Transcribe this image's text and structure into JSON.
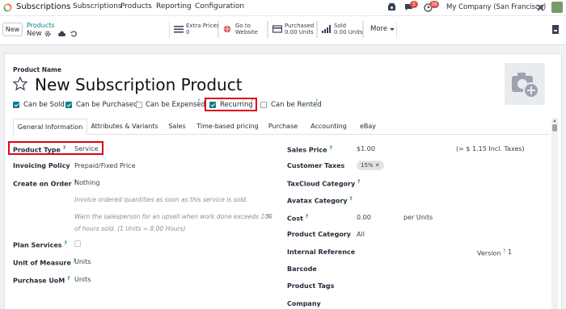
{
  "navbar": {
    "app_name": "Subscriptions",
    "menus": [
      "Subscriptions",
      "Products",
      "Reporting",
      "Configuration"
    ],
    "chat_count": "5",
    "activity_count": "36",
    "company": "My Company (San Francisco)"
  },
  "control_panel": {
    "new_label": "New",
    "breadcrumb_parent": "Products",
    "breadcrumb_current": "New",
    "smart_buttons": {
      "extra_prices": {
        "label": "Extra Prices",
        "value": "0"
      },
      "website": {
        "label": "Go to",
        "value": "Website"
      },
      "purchased": {
        "label": "Purchased",
        "value": "0.00 Units"
      },
      "sold": {
        "label": "Sold",
        "value": "0.00 Units"
      },
      "more": "More"
    }
  },
  "form": {
    "product_name_label": "Product Name",
    "product_name": "New Subscription Product",
    "checkboxes": {
      "can_be_sold": "Can be Sold",
      "can_be_purchased": "Can be Purchased",
      "can_be_expensed": "Can be Expensed",
      "recurring": "Recurring",
      "can_be_rented": "Can be Rented"
    },
    "tabs": [
      "General Information",
      "Attributes & Variants",
      "Sales",
      "Time-based pricing",
      "Purchase",
      "Accounting",
      "eBay"
    ],
    "left": {
      "product_type_label": "Product Type",
      "product_type": "Service",
      "invoicing_policy_label": "Invoicing Policy",
      "invoicing_policy": "Prepaid/Fixed Price",
      "create_on_order_label": "Create on Order",
      "create_on_order": "Nothing",
      "help_text_1": "Invoice ordered quantities as soon as this service is sold.",
      "help_text_2a": "Warn the salesperson for an upsell when work done exceeds 100",
      "help_text_2_pct": "%",
      "help_text_2b": "of hours sold. (1 Units = 8.00 Hours)",
      "plan_services_label": "Plan Services",
      "unit_of_measure_label": "Unit of Measure",
      "unit_of_measure": "Units",
      "purchase_uom_label": "Purchase UoM",
      "purchase_uom": "Units"
    },
    "right": {
      "sales_price_label": "Sales Price",
      "sales_price": "$1.00",
      "sales_price_incl": "(= $ 1.15 Incl. Taxes)",
      "customer_taxes_label": "Customer Taxes",
      "customer_taxes_tag": "15%",
      "taxcloud_label": "TaxCloud Category",
      "avatax_label": "Avatax Category",
      "cost_label": "Cost",
      "cost": "0.00",
      "cost_unit": "per Units",
      "product_category_label": "Product Category",
      "product_category": "All",
      "internal_reference_label": "Internal Reference",
      "version_label": "Version",
      "version": "1",
      "barcode_label": "Barcode",
      "product_tags_label": "Product Tags",
      "company_label": "Company"
    }
  },
  "colors": {
    "accent": "#017e84",
    "brand": "#714b67",
    "highlight": "#e0001a",
    "badge": "#d9534f"
  }
}
